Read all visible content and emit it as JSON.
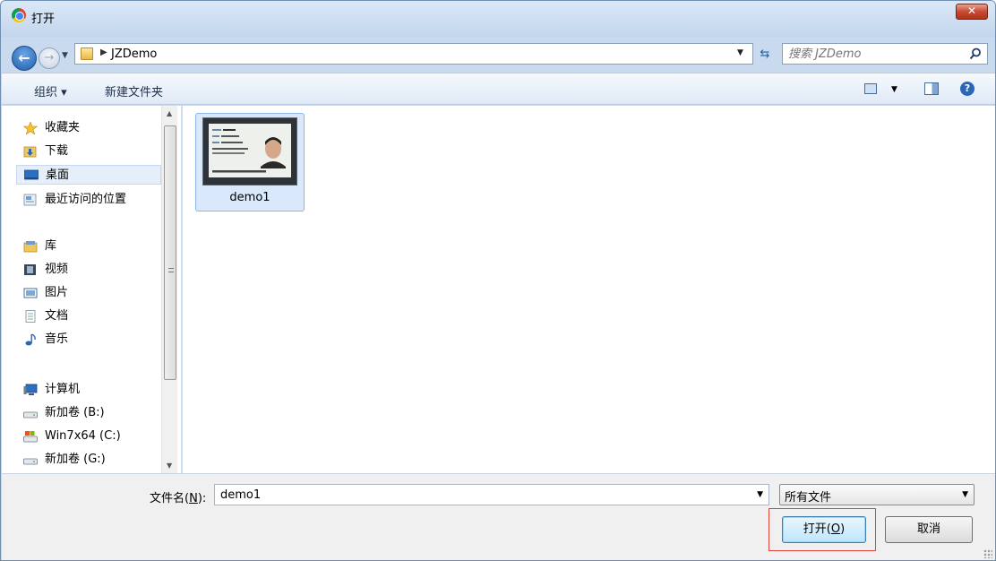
{
  "window": {
    "title": "打开",
    "close_label": "✕"
  },
  "address": {
    "breadcrumb": "JZDemo",
    "search_placeholder": "搜索 JZDemo"
  },
  "toolbar": {
    "organize_label": "组织 ▾",
    "new_folder_label": "新建文件夹"
  },
  "nav": {
    "favorites": "收藏夹",
    "downloads": "下载",
    "desktop": "桌面",
    "recent": "最近访问的位置",
    "libraries": "库",
    "videos": "视频",
    "pictures": "图片",
    "documents": "文档",
    "music": "音乐",
    "computer": "计算机",
    "drive_b": "新加卷 (B:)",
    "drive_c": "Win7x64 (C:)",
    "drive_g": "新加卷 (G:)"
  },
  "files": [
    {
      "name": "demo1"
    }
  ],
  "footer": {
    "filename_label_prefix": "文件名(",
    "filename_label_key": "N",
    "filename_label_suffix": "):",
    "filename_value": "demo1",
    "filter_value": "所有文件",
    "open_prefix": "打开(",
    "open_key": "O",
    "open_suffix": ")",
    "cancel_label": "取消"
  },
  "colors": {
    "accent": "#1f5ea8",
    "selection": "#d9e8fb",
    "highlight": "#e0423c"
  }
}
